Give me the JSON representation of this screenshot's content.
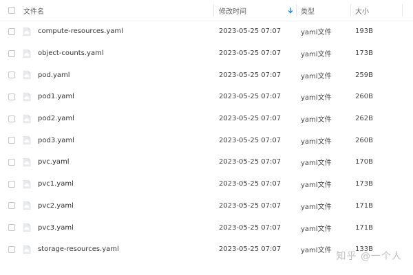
{
  "header": {
    "name_label": "文件名",
    "date_label": "修改时间",
    "type_label": "类型",
    "size_label": "大小"
  },
  "sort": {
    "column": "修改时间",
    "direction": "descending",
    "icon": "arrow-down-icon"
  },
  "colors": {
    "accent": "#1e88e5",
    "icon_bg": "#e8eaed",
    "icon_fg": "#ffffff"
  },
  "rows": [
    {
      "name": "compute-resources.yaml",
      "modified": "2023-05-25 07:07",
      "type": "yaml文件",
      "size": "193B"
    },
    {
      "name": "object-counts.yaml",
      "modified": "2023-05-25 07:07",
      "type": "yaml文件",
      "size": "173B"
    },
    {
      "name": "pod.yaml",
      "modified": "2023-05-25 07:07",
      "type": "yaml文件",
      "size": "259B"
    },
    {
      "name": "pod1.yaml",
      "modified": "2023-05-25 07:07",
      "type": "yaml文件",
      "size": "260B"
    },
    {
      "name": "pod2.yaml",
      "modified": "2023-05-25 07:07",
      "type": "yaml文件",
      "size": "262B"
    },
    {
      "name": "pod3.yaml",
      "modified": "2023-05-25 07:07",
      "type": "yaml文件",
      "size": "260B"
    },
    {
      "name": "pvc.yaml",
      "modified": "2023-05-25 07:07",
      "type": "yaml文件",
      "size": "170B"
    },
    {
      "name": "pvc1.yaml",
      "modified": "2023-05-25 07:07",
      "type": "yaml文件",
      "size": "173B"
    },
    {
      "name": "pvc2.yaml",
      "modified": "2023-05-25 07:07",
      "type": "yaml文件",
      "size": "171B"
    },
    {
      "name": "pvc3.yaml",
      "modified": "2023-05-25 07:07",
      "type": "yaml文件",
      "size": "171B"
    },
    {
      "name": "storage-resources.yaml",
      "modified": "2023-05-25 07:07",
      "type": "yaml文件",
      "size": "133B"
    }
  ],
  "watermark": "知乎 @一个人"
}
